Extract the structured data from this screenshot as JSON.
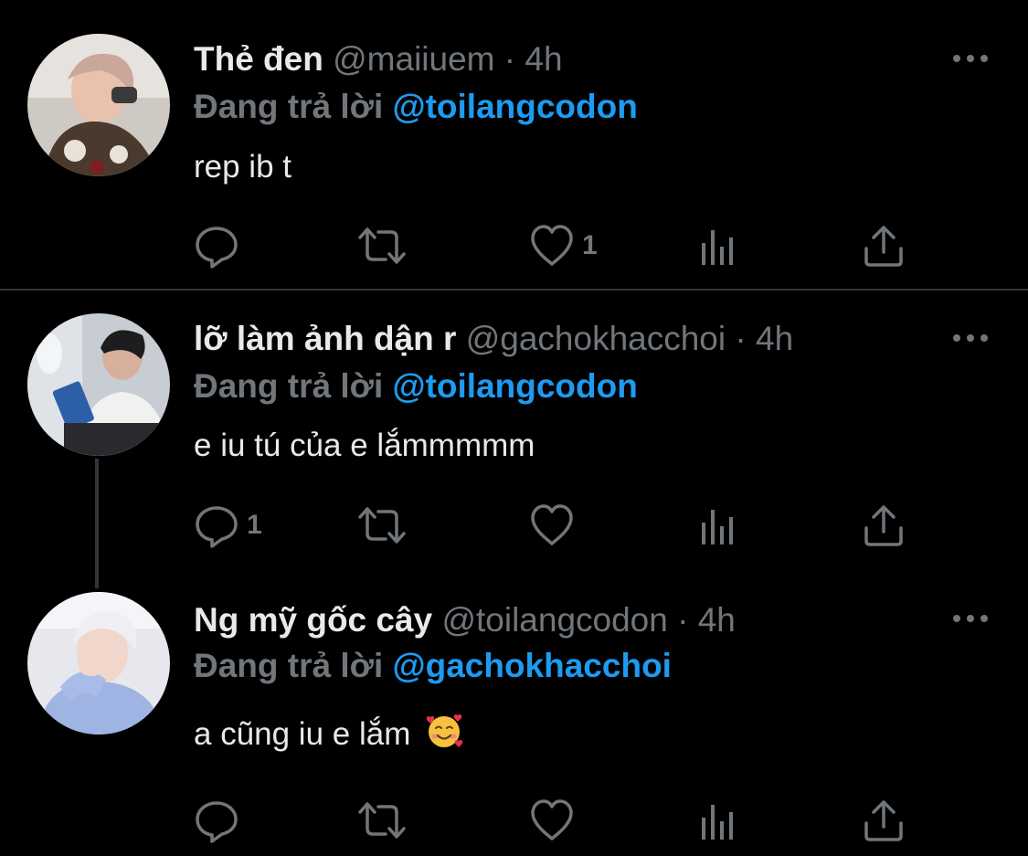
{
  "tweets": [
    {
      "display_name": "Thẻ đen",
      "handle": "@maiiuem",
      "separator": "·",
      "time": "4h",
      "reply_prefix": "Đang trả lời",
      "reply_to": "@toilangcodon",
      "text": "rep ib t",
      "counts": {
        "reply": "",
        "retweet": "",
        "like": "1"
      },
      "icons": [
        "reply-icon",
        "retweet-icon",
        "like-icon",
        "analytics-icon",
        "share-icon",
        "more-icon"
      ]
    },
    {
      "display_name": "lỡ làm ảnh dận r",
      "handle": "@gachokhacchoi",
      "separator": "·",
      "time": "4h",
      "reply_prefix": "Đang trả lời",
      "reply_to": "@toilangcodon",
      "text": "e iu tú của e lắmmmmm",
      "counts": {
        "reply": "1",
        "retweet": "",
        "like": ""
      },
      "icons": [
        "reply-icon",
        "retweet-icon",
        "like-icon",
        "analytics-icon",
        "share-icon",
        "more-icon"
      ]
    },
    {
      "display_name": "Ng mỹ gốc cây",
      "handle": "@toilangcodon",
      "separator": "·",
      "time": "4h",
      "reply_prefix": "Đang trả lời",
      "reply_to": "@gachokhacchoi",
      "text": "a cũng iu e lắm",
      "emoji": "smiling-face-with-hearts-icon",
      "counts": {
        "reply": "",
        "retweet": "",
        "like": ""
      },
      "icons": [
        "reply-icon",
        "retweet-icon",
        "like-icon",
        "analytics-icon",
        "share-icon",
        "more-icon"
      ]
    }
  ],
  "colors": {
    "background": "#000000",
    "text_primary": "#e7e9ea",
    "text_secondary": "#71767b",
    "accent": "#1d9bf0",
    "divider": "#2f3336",
    "thread_line": "#333639"
  }
}
